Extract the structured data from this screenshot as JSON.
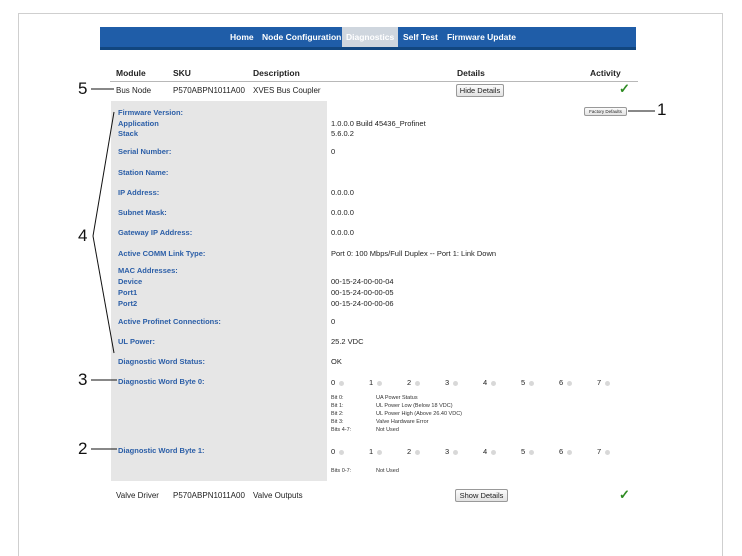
{
  "nav": {
    "tabs": [
      {
        "label": "Home",
        "active": false
      },
      {
        "label": "Node Configuration",
        "active": false
      },
      {
        "label": "Diagnostics",
        "active": true
      },
      {
        "label": "Self Test",
        "active": false
      },
      {
        "label": "Firmware Update",
        "active": false
      }
    ]
  },
  "table": {
    "headers": {
      "module": "Module",
      "sku": "SKU",
      "description": "Description",
      "details": "Details",
      "activity": "Activity"
    },
    "bus_node": {
      "module": "Bus Node",
      "sku": "P570ABPN1011A00",
      "description": "XVES Bus Coupler",
      "button": "Hide Details",
      "activity": "✓"
    },
    "valve_driver": {
      "module": "Valve Driver",
      "sku": "P570ABPN1011A00",
      "description": "Valve Outputs",
      "button": "Show Details",
      "activity": "✓"
    }
  },
  "factory_defaults_label": "Factory Defaults",
  "details": {
    "firmware_version": "Firmware Version:",
    "application_label": "Application",
    "application_value": "1.0.0.0 Build 45436_Profinet",
    "stack_label": "Stack",
    "stack_value": "5.6.0.2",
    "serial_label": "Serial Number:",
    "serial_value": "0",
    "station_label": "Station Name:",
    "ip_label": "IP Address:",
    "ip_value": "0.0.0.0",
    "subnet_label": "Subnet Mask:",
    "subnet_value": "0.0.0.0",
    "gateway_label": "Gateway IP Address:",
    "gateway_value": "0.0.0.0",
    "comm_label": "Active COMM Link Type:",
    "comm_value": "Port 0: 100 Mbps/Full Duplex -- Port 1: Link Down",
    "mac_label": "MAC Addresses:",
    "device_label": "Device",
    "device_value": "00-15-24-00-00-04",
    "port1_label": "Port1",
    "port1_value": "00-15-24-00-00-05",
    "port2_label": "Port2",
    "port2_value": "00-15-24-00-00-06",
    "profinet_label": "Active Profinet Connections:",
    "profinet_value": "0",
    "ulpower_label": "UL Power:",
    "ulpower_value": "25.2 VDC",
    "dws_label": "Diagnostic Word Status:",
    "dws_value": "OK",
    "byte0_label": "Diagnostic Word Byte 0:",
    "byte1_label": "Diagnostic Word Byte 1:",
    "bits": [
      "0",
      "1",
      "2",
      "3",
      "4",
      "5",
      "6",
      "7"
    ],
    "byte0_legend": [
      {
        "bit": "Bit 0:",
        "desc": "UA Power Status"
      },
      {
        "bit": "Bit 1:",
        "desc": "UL Power Low (Below 18 VDC)"
      },
      {
        "bit": "Bit 2:",
        "desc": "UL Power High (Above 26.40 VDC)"
      },
      {
        "bit": "Bit 3:",
        "desc": "Valve Hardware Error"
      },
      {
        "bit": "Bits 4-7:",
        "desc": "Not Used"
      }
    ],
    "byte1_legend": [
      {
        "bit": "Bits 0-7:",
        "desc": "Not Used"
      }
    ]
  },
  "callouts": [
    "1",
    "2",
    "3",
    "4",
    "5"
  ]
}
